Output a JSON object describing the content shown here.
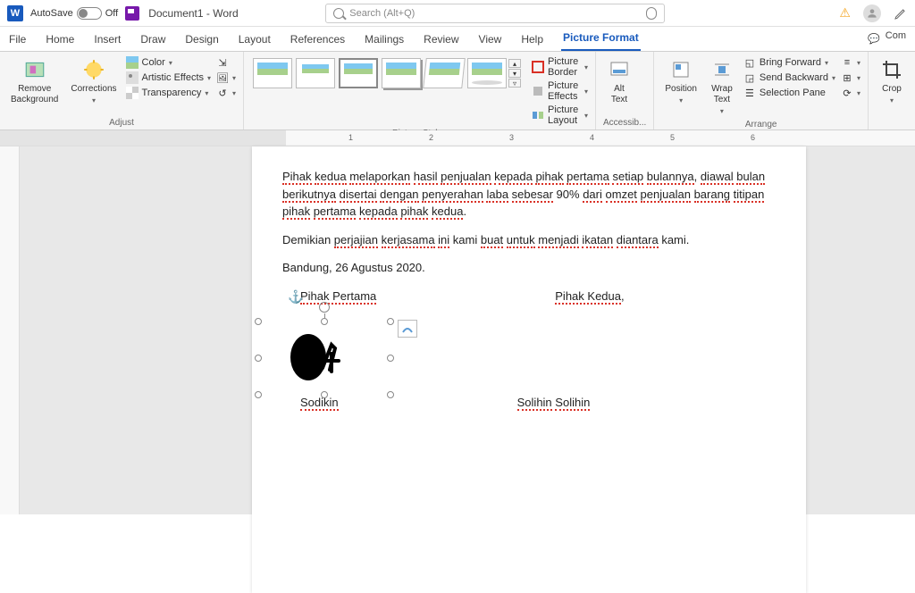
{
  "titlebar": {
    "autosave_label": "AutoSave",
    "autosave_state": "Off",
    "doc_title": "Document1 - Word",
    "search_placeholder": "Search (Alt+Q)"
  },
  "menutabs": {
    "items": [
      "File",
      "Home",
      "Insert",
      "Draw",
      "Design",
      "Layout",
      "References",
      "Mailings",
      "Review",
      "View",
      "Help",
      "Picture Format"
    ],
    "active": "Picture Format",
    "comments": "Com"
  },
  "ribbon": {
    "adjust": {
      "remove_bg": "Remove\nBackground",
      "corrections": "Corrections",
      "color": "Color",
      "artistic": "Artistic Effects",
      "transparency": "Transparency",
      "group_label": "Adjust"
    },
    "styles": {
      "border": "Picture Border",
      "effects": "Picture Effects",
      "layout": "Picture Layout",
      "group_label": "Picture Styles"
    },
    "access": {
      "alt_text": "Alt\nText",
      "group_label": "Accessib..."
    },
    "arrange": {
      "position": "Position",
      "wrap": "Wrap\nText",
      "bring_forward": "Bring Forward",
      "send_backward": "Send Backward",
      "selection_pane": "Selection Pane",
      "group_label": "Arrange"
    },
    "size": {
      "crop": "Crop"
    }
  },
  "ruler": {
    "marks": [
      "1",
      "2",
      "3",
      "4",
      "5",
      "6"
    ]
  },
  "document": {
    "para1_words": [
      "Pihak",
      "kedua",
      "melaporkan",
      "hasil",
      "penjualan",
      "kepada",
      "pihak",
      "pertama",
      "setiap",
      "bulannya",
      ",",
      "diawal",
      "bulan",
      "berikutnya",
      "disertai",
      "dengan",
      "penyerahan",
      "laba",
      "sebesar",
      "90%",
      "dari",
      "omzet",
      "penjualan",
      "barang",
      "titipan",
      "pihak",
      "pertama",
      "kepada",
      "pihak",
      "kedua",
      "."
    ],
    "para2_parts": [
      "Demikian ",
      "perjajian",
      " ",
      "kerjasama",
      " ",
      "ini",
      " kami ",
      "buat",
      " ",
      "untuk",
      " ",
      "menjadi",
      " ",
      "ikatan",
      " ",
      "diantara",
      " kami."
    ],
    "date_line": "Bandung, 26 Agustus 2020.",
    "party1": "Pihak Pertama",
    "party2": "Pihak Kedua",
    "name1": "Sodikin",
    "name2a": "Solihin",
    "name2b": "Solihin"
  }
}
